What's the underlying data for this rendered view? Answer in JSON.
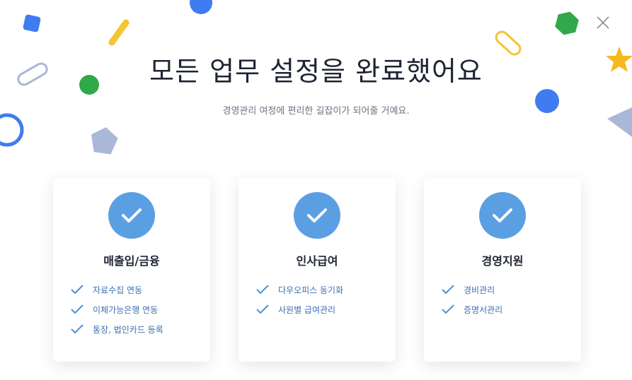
{
  "title": "모든 업무 설정을 완료했어요",
  "subtitle": "경영관리 여정에 편리한 길잡이가 되어줄 거예요.",
  "close_icon": "close-icon",
  "colors": {
    "accent": "#4a90d9",
    "check_circle": "#5b9fe3",
    "title": "#1f2433",
    "subtitle": "#6b7280",
    "item_text": "#3c6fb0"
  },
  "cards": [
    {
      "title": "매출입/금융",
      "items": [
        "자료수집 연동",
        "이체가능은행 연동",
        "통장, 법인카드 등록"
      ]
    },
    {
      "title": "인사급여",
      "items": [
        "다우오피스 동기화",
        "사원별 급여관리"
      ]
    },
    {
      "title": "경영지원",
      "items": [
        "경비관리",
        "증명서관리"
      ]
    }
  ]
}
